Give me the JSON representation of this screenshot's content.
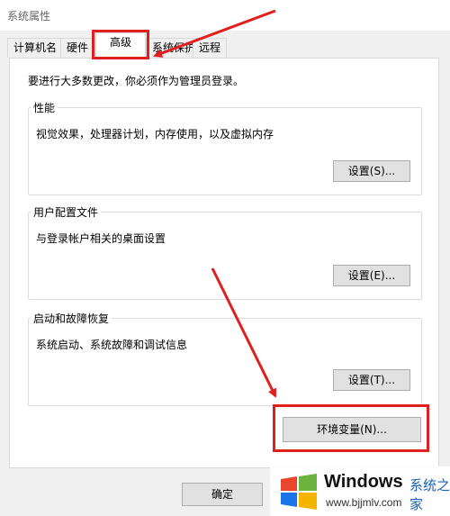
{
  "window": {
    "title": "系统属性"
  },
  "tabs": [
    {
      "label": "计算机名"
    },
    {
      "label": "硬件"
    },
    {
      "label": "高级"
    },
    {
      "label": "系统保护"
    },
    {
      "label": "远程"
    }
  ],
  "panel": {
    "admin_note": "要进行大多数更改，你必须作为管理员登录。",
    "performance": {
      "title": "性能",
      "desc": "视觉效果，处理器计划，内存使用，以及虚拟内存",
      "button": "设置(S)..."
    },
    "user_profiles": {
      "title": "用户配置文件",
      "desc": "与登录帐户相关的桌面设置",
      "button": "设置(E)..."
    },
    "startup_recovery": {
      "title": "启动和故障恢复",
      "desc": "系统启动、系统故障和调试信息",
      "button": "设置(T)..."
    },
    "env_button": "环境变量(N)..."
  },
  "footer": {
    "ok_label": "确定"
  },
  "watermark": {
    "title": "Windows",
    "sub": "系统之家",
    "url": "www.bjjmlv.com"
  },
  "colors": {
    "annotation_red": "#e02020",
    "panel_bg": "#ffffff",
    "window_bg": "#f0f0f0"
  }
}
